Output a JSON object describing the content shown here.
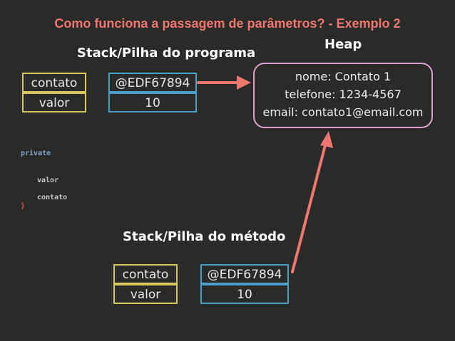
{
  "title": "Como funciona a passagem de parâmetros? - Exemplo 2",
  "program_stack": {
    "heading": "Stack/Pilha do programa",
    "rows": [
      {
        "name": "contato",
        "value": "@EDF67894"
      },
      {
        "name": "valor",
        "value": "10"
      }
    ]
  },
  "heap": {
    "heading": "Heap",
    "lines": [
      "nome: Contato 1",
      "telefone: 1234-4567",
      "email: contato1@email.com"
    ]
  },
  "method_stack": {
    "heading": "Stack/Pilha do método",
    "rows": [
      {
        "name": "contato",
        "value": "@EDF67894"
      },
      {
        "name": "valor",
        "value": "10"
      }
    ]
  },
  "code": {
    "line1": "private",
    "line2": "valor",
    "line3": "contato",
    "line4": "}"
  },
  "colors": {
    "title": "#f07670",
    "arrow": "#f07670",
    "name_border": "#d7c95e",
    "value_border": "#4aa0c8",
    "heap_border": "#dca1d2",
    "code_private": "#7fa3c8",
    "code_text": "#c8c8c8",
    "code_brace": "#e05050"
  }
}
